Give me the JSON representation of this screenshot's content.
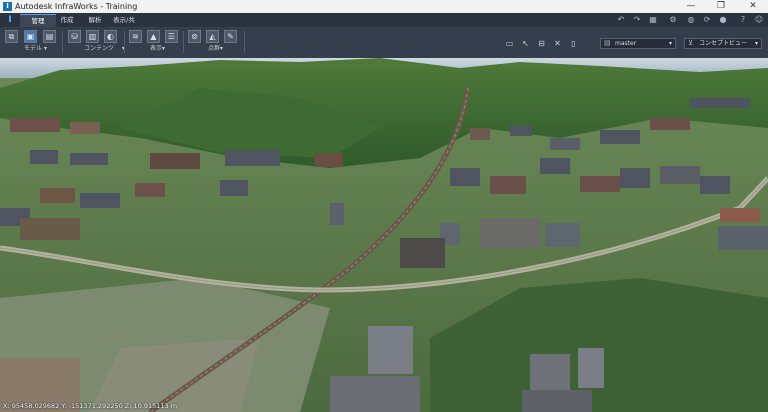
{
  "window": {
    "app_title": "Autodesk InfraWorks - Training",
    "min_glyph": "—",
    "max_glyph": "❐",
    "close_glyph": "✕",
    "app_icon_glyph": "I"
  },
  "ribbon_tabs": [
    {
      "label": "管理"
    },
    {
      "label": "作成"
    },
    {
      "label": "解析"
    },
    {
      "label": "表示/共有"
    }
  ],
  "ribbon_groups": {
    "model": "モデル",
    "contents": "コンテンツ",
    "display": "表示",
    "pointcloud": "点群"
  },
  "proposal": {
    "value": "master"
  },
  "style": {
    "value": "コンセプトビュー"
  },
  "status_bar": {
    "coordinates": "X: 95458.029682 Y: -151371.292250 Z: 10.915113 m"
  },
  "colors": {
    "accent": "#5aa0e6",
    "ribbon_bg": "#353e4c",
    "tab_bg": "#2b3340"
  },
  "icons": [
    "undo-icon",
    "redo-icon",
    "settings-icon",
    "help-icon",
    "user-icon",
    "select-icon",
    "measure-icon",
    "axis-icon"
  ]
}
